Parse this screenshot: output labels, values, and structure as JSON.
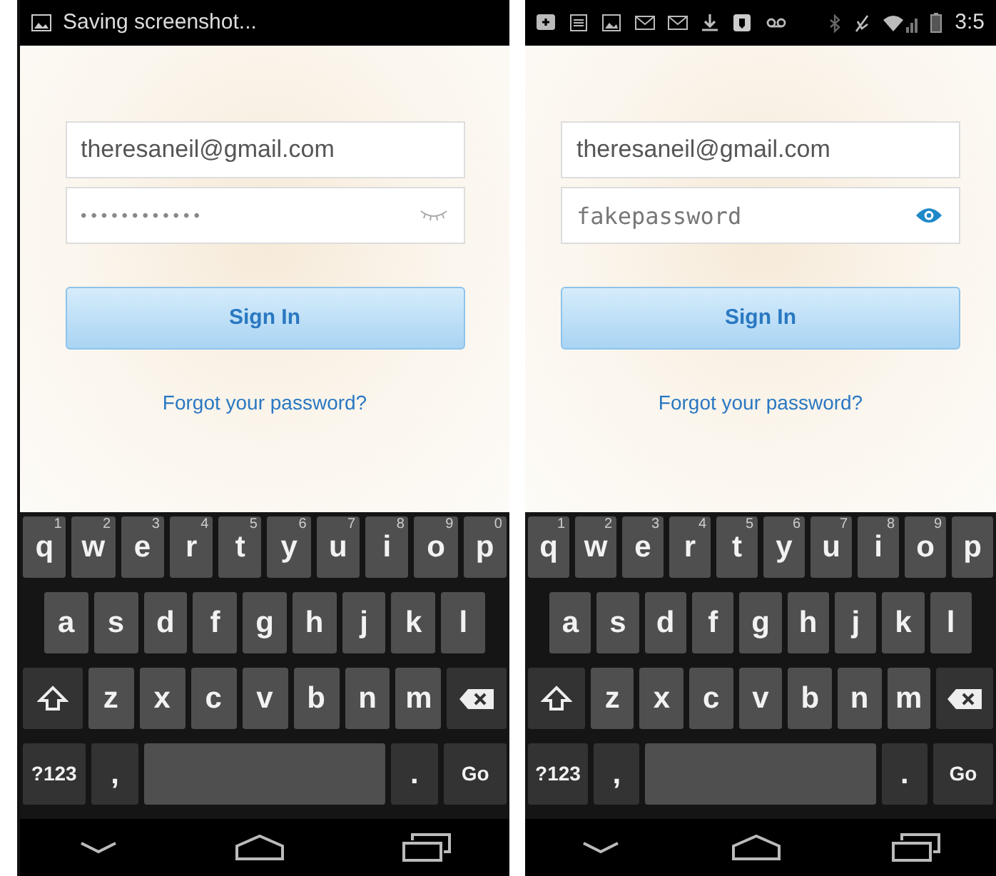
{
  "phones": [
    {
      "status_bar": {
        "kind": "ticker",
        "text": "Saving screenshot..."
      },
      "email": "theresaneil@gmail.com",
      "password": {
        "value": "••••••••••••",
        "visible": false
      },
      "sign_in": "Sign In",
      "forgot_link": "Forgot your password?",
      "keyboard": [
        [
          {
            "kind": "char",
            "label": "q",
            "hint": "1"
          },
          {
            "kind": "char",
            "label": "w",
            "hint": "2"
          },
          {
            "kind": "char",
            "label": "e",
            "hint": "3"
          },
          {
            "kind": "char",
            "label": "r",
            "hint": "4"
          },
          {
            "kind": "char",
            "label": "t",
            "hint": "5"
          },
          {
            "kind": "char",
            "label": "y",
            "hint": "6"
          },
          {
            "kind": "char",
            "label": "u",
            "hint": "7"
          },
          {
            "kind": "char",
            "label": "i",
            "hint": "8"
          },
          {
            "kind": "char",
            "label": "o",
            "hint": "9"
          },
          {
            "kind": "char",
            "label": "p",
            "hint": "0"
          }
        ],
        [
          {
            "kind": "char",
            "label": "a"
          },
          {
            "kind": "char",
            "label": "s"
          },
          {
            "kind": "char",
            "label": "d"
          },
          {
            "kind": "char",
            "label": "f"
          },
          {
            "kind": "char",
            "label": "g"
          },
          {
            "kind": "char",
            "label": "h"
          },
          {
            "kind": "char",
            "label": "j"
          },
          {
            "kind": "char",
            "label": "k"
          },
          {
            "kind": "char",
            "label": "l"
          }
        ],
        [
          {
            "kind": "shift"
          },
          {
            "kind": "char",
            "label": "z"
          },
          {
            "kind": "char",
            "label": "x"
          },
          {
            "kind": "char",
            "label": "c"
          },
          {
            "kind": "char",
            "label": "v"
          },
          {
            "kind": "char",
            "label": "b"
          },
          {
            "kind": "char",
            "label": "n"
          },
          {
            "kind": "char",
            "label": "m"
          },
          {
            "kind": "delete"
          }
        ],
        [
          {
            "kind": "mode",
            "label": "?123"
          },
          {
            "kind": "punct",
            "label": ","
          },
          {
            "kind": "space"
          },
          {
            "kind": "punct",
            "label": "."
          },
          {
            "kind": "mode",
            "label": "Go"
          }
        ]
      ]
    },
    {
      "status_bar": {
        "kind": "icons",
        "time": "3:5"
      },
      "email": "theresaneil@gmail.com",
      "password": {
        "value": "fakepassword",
        "visible": true
      },
      "sign_in": "Sign In",
      "forgot_link": "Forgot your password?",
      "keyboard": [
        [
          {
            "kind": "char",
            "label": "q",
            "hint": "1"
          },
          {
            "kind": "char",
            "label": "w",
            "hint": "2"
          },
          {
            "kind": "char",
            "label": "e",
            "hint": "3"
          },
          {
            "kind": "char",
            "label": "r",
            "hint": "4"
          },
          {
            "kind": "char",
            "label": "t",
            "hint": "5"
          },
          {
            "kind": "char",
            "label": "y",
            "hint": "6"
          },
          {
            "kind": "char",
            "label": "u",
            "hint": "7"
          },
          {
            "kind": "char",
            "label": "i",
            "hint": "8"
          },
          {
            "kind": "char",
            "label": "o",
            "hint": "9"
          },
          {
            "kind": "char",
            "label": "p"
          }
        ],
        [
          {
            "kind": "char",
            "label": "a"
          },
          {
            "kind": "char",
            "label": "s"
          },
          {
            "kind": "char",
            "label": "d"
          },
          {
            "kind": "char",
            "label": "f"
          },
          {
            "kind": "char",
            "label": "g"
          },
          {
            "kind": "char",
            "label": "h"
          },
          {
            "kind": "char",
            "label": "j"
          },
          {
            "kind": "char",
            "label": "k"
          },
          {
            "kind": "char",
            "label": "l"
          }
        ],
        [
          {
            "kind": "shift"
          },
          {
            "kind": "char",
            "label": "z"
          },
          {
            "kind": "char",
            "label": "x"
          },
          {
            "kind": "char",
            "label": "c"
          },
          {
            "kind": "char",
            "label": "v"
          },
          {
            "kind": "char",
            "label": "b"
          },
          {
            "kind": "char",
            "label": "n"
          },
          {
            "kind": "char",
            "label": "m"
          },
          {
            "kind": "delete"
          }
        ],
        [
          {
            "kind": "mode",
            "label": "?123"
          },
          {
            "kind": "punct",
            "label": ","
          },
          {
            "kind": "space"
          },
          {
            "kind": "punct",
            "label": "."
          },
          {
            "kind": "mode",
            "label": "Go"
          }
        ]
      ]
    }
  ]
}
